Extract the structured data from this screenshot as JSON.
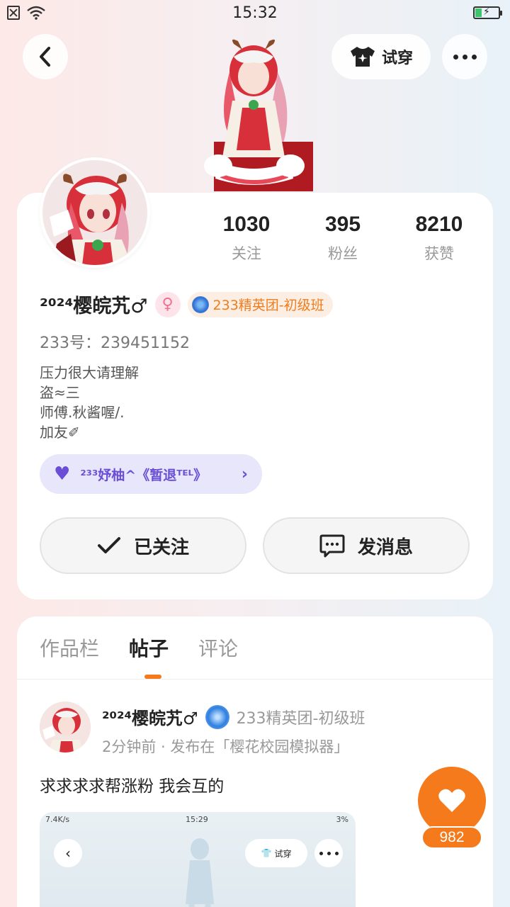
{
  "status_bar": {
    "time": "15:32"
  },
  "top_bar": {
    "try_on_label": "试穿"
  },
  "profile": {
    "stats": [
      {
        "value": "1030",
        "label": "关注"
      },
      {
        "value": "395",
        "label": "粉丝"
      },
      {
        "value": "8210",
        "label": "获赞"
      }
    ],
    "username": "²⁰²⁴樱皖艽♂",
    "gender_symbol": "♀",
    "group_badge": "233精英团-初级班",
    "uid": "233号：239451152",
    "bio": [
      "压力很大请理解",
      "盗≈三",
      "师傅.秋酱喔/.",
      "加友✐"
    ],
    "guild": "²³³妤柚^《暂退ᵀᴱᴸ》",
    "follow_label": "已关注",
    "message_label": "发消息"
  },
  "tabs": [
    {
      "label": "作品栏",
      "active": false
    },
    {
      "label": "帖子",
      "active": true
    },
    {
      "label": "评论",
      "active": false
    }
  ],
  "post": {
    "author": "²⁰²⁴樱皖艽♂",
    "badge": "233精英团-初级班",
    "meta": "2分钟前 · 发布在「樱花校园模拟器」",
    "text": "求求求求帮涨粉  我会互的",
    "image": {
      "status_left": "7.4K/s",
      "status_time": "15:29",
      "status_right": "3%",
      "try_on_label": "试穿"
    }
  },
  "like": {
    "count": "982"
  },
  "colors": {
    "accent": "#f47a1c",
    "guild": "#6a4fd6",
    "badge_text": "#f07c1e"
  }
}
